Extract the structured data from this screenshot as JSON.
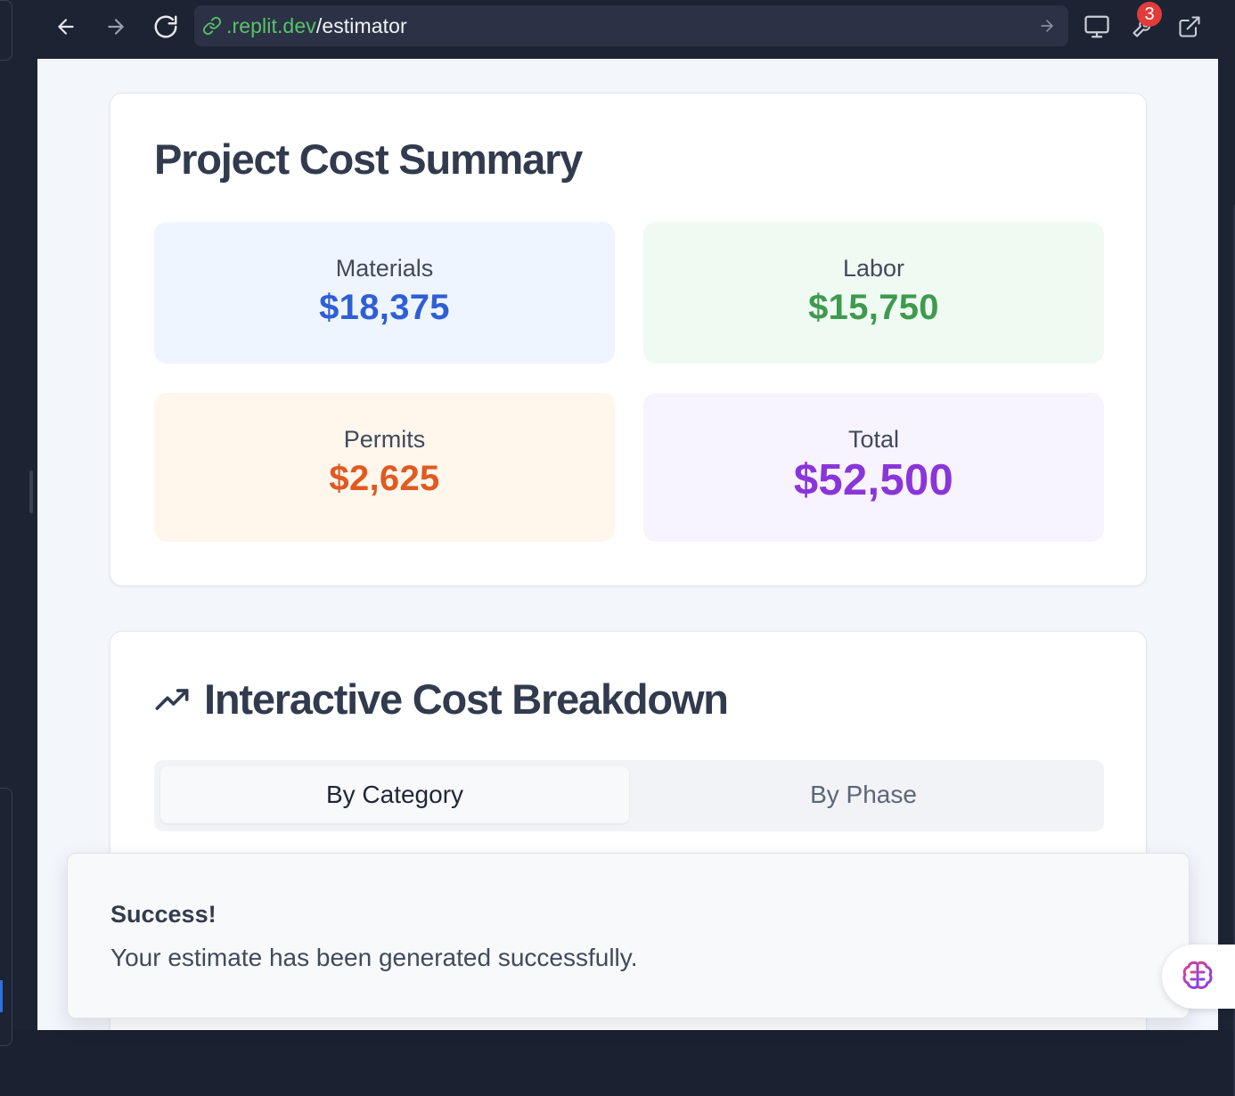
{
  "browser": {
    "url_domain": ".replit.dev",
    "url_path": "/estimator",
    "notification_count": "3"
  },
  "summary": {
    "title": "Project Cost Summary",
    "stats": [
      {
        "label": "Materials",
        "value": "$18,375",
        "color": "#2f5fd6"
      },
      {
        "label": "Labor",
        "value": "$15,750",
        "color": "#3f9a4f"
      },
      {
        "label": "Permits",
        "value": "$2,625",
        "color": "#e05a21"
      },
      {
        "label": "Total",
        "value": "$52,500",
        "color": "#8a35d9"
      }
    ]
  },
  "breakdown": {
    "title": "Interactive Cost Breakdown",
    "tabs": [
      {
        "label": "By Category",
        "active": true
      },
      {
        "label": "By Phase",
        "active": false
      }
    ]
  },
  "toast": {
    "title": "Success!",
    "description": "Your estimate has been generated successfully."
  },
  "icons": {
    "back": "arrow-left-icon",
    "forward": "arrow-right-icon",
    "reload": "refresh-icon",
    "link": "link-icon",
    "go": "arrow-right-icon",
    "devices": "monitor-icon",
    "tools": "wrench-icon",
    "open_external": "external-link-icon",
    "trend": "trending-up-icon",
    "assistant": "brain-icon"
  }
}
